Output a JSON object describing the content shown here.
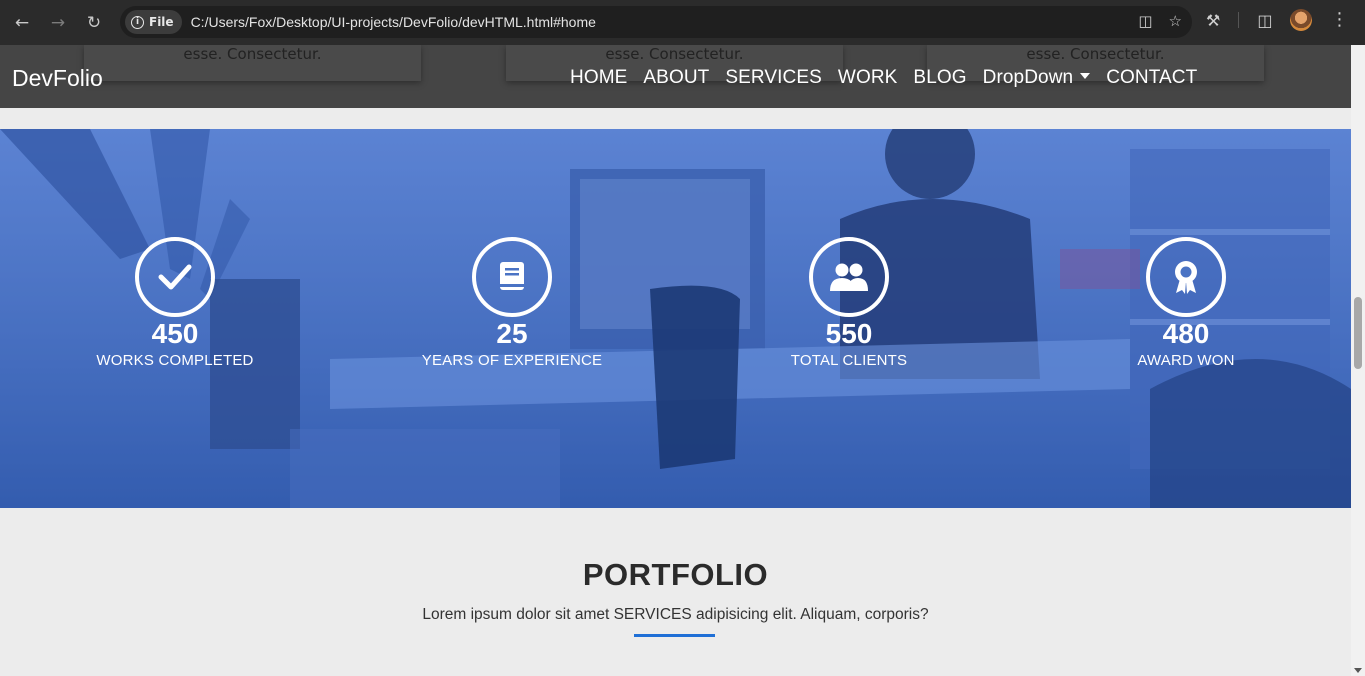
{
  "browser": {
    "chip_label": "File",
    "url": "C:/Users/Fox/Desktop/UI-projects/DevFolio/devHTML.html#home"
  },
  "header": {
    "brand": "DevFolio",
    "ghost_text": "esse. Consectetur.",
    "menu": [
      "HOME",
      "ABOUT",
      "SERVICES",
      "WORK",
      "BLOG",
      "DropDown",
      "CONTACT"
    ]
  },
  "counters": [
    {
      "icon": "check-icon",
      "value": "450",
      "label": "WORKS COMPLETED"
    },
    {
      "icon": "book-icon",
      "value": "25",
      "label": "YEARS OF EXPERIENCE"
    },
    {
      "icon": "users-icon",
      "value": "550",
      "label": "TOTAL CLIENTS"
    },
    {
      "icon": "award-icon",
      "value": "480",
      "label": "AWARD WON"
    }
  ],
  "portfolio": {
    "title": "PORTFOLIO",
    "subtitle": "Lorem ipsum dolor sit amet SERVICES adipisicing elit. Aliquam, corporis?"
  },
  "colors": {
    "accent": "#1f6fd6",
    "header_bg": "#454545",
    "hero_overlay": "#4a73c4"
  }
}
